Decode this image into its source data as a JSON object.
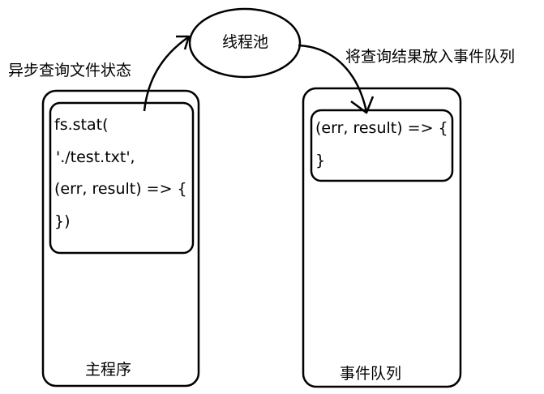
{
  "labels": {
    "async_query": "异步查询文件状态",
    "thread_pool": "线程池",
    "put_result": "将查询结果放入事件队列",
    "main_program": "主程序",
    "event_queue": "事件队列"
  },
  "main_code": {
    "line1": "fs.stat(",
    "line2": "'./test.txt',",
    "line3": "(err, result) => {",
    "line4": "})"
  },
  "queue_code": {
    "line1": "(err, result) => {",
    "line2": "}"
  }
}
